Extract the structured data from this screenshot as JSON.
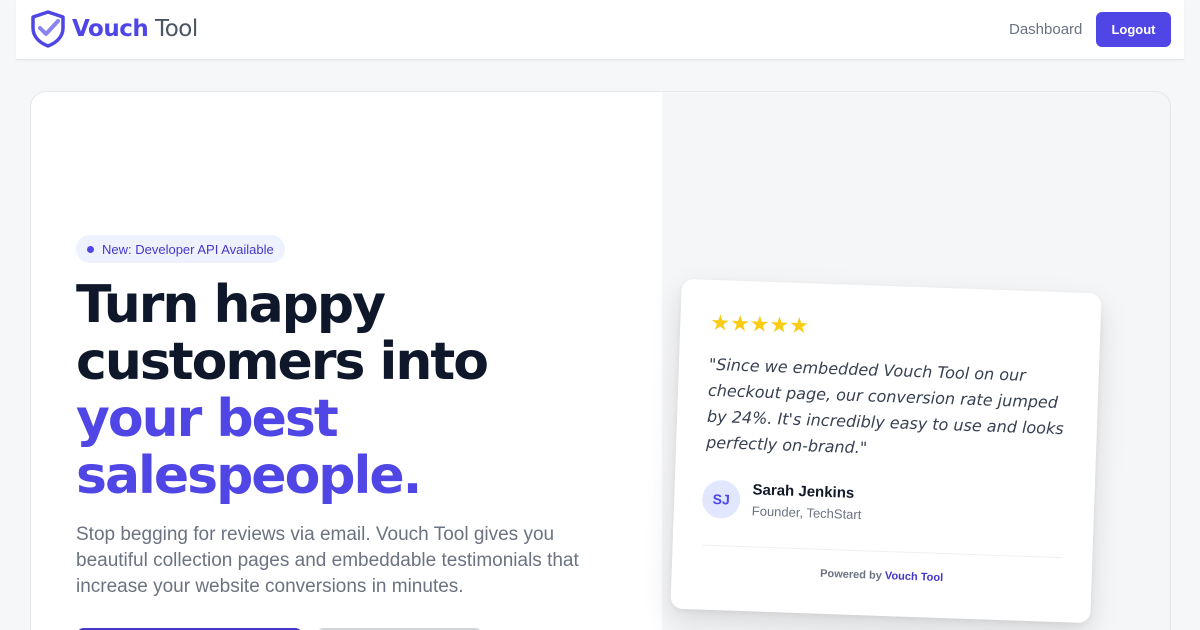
{
  "nav": {
    "brand_primary": "Vouch",
    "brand_secondary": "Tool",
    "dashboard_label": "Dashboard",
    "logout_label": "Logout"
  },
  "hero": {
    "badge": "New: Developer API Available",
    "headline_line1": "Turn happy",
    "headline_line2": "customers into",
    "headline_line3": "your best",
    "headline_line4": "salespeople.",
    "subtext": "Stop begging for reviews via email. Vouch Tool gives you beautiful collection pages and embeddable testimonials that increase your website conversions in minutes."
  },
  "testimonial": {
    "rating": 5,
    "stars": "★★★★★",
    "quote": "\"Since we embedded Vouch Tool on our checkout page, our conversion rate jumped by 24%. It's incredibly easy to use and looks perfectly on-brand.\"",
    "avatar_initials": "SJ",
    "author_name": "Sarah Jenkins",
    "author_role": "Founder, TechStart",
    "powered_prefix": "Powered by",
    "powered_brand": "Vouch Tool"
  },
  "colors": {
    "accent": "#4f46e5",
    "star": "#facc15",
    "heading": "#0f172a",
    "muted": "#6b7280"
  }
}
